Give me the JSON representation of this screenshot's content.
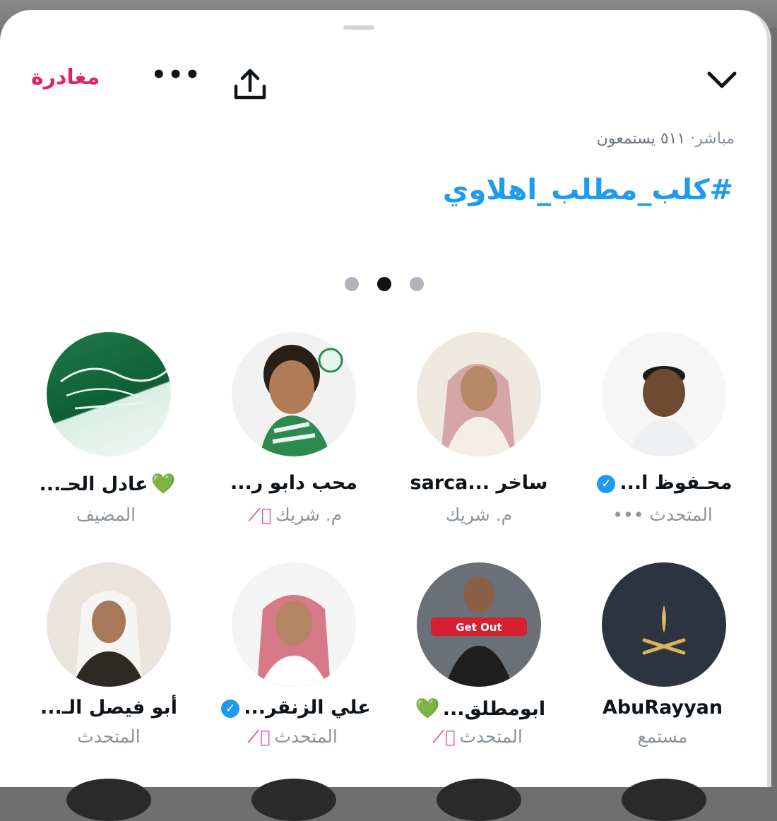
{
  "header": {
    "leave_label": "مغادرة",
    "more_label": "•••",
    "share_icon": "share-icon",
    "collapse_icon": "chevron-down-icon"
  },
  "space": {
    "live_label": "مباشر·",
    "listeners_text": "٥١١ يستمعون",
    "title": "#كلب_مطلب_اهلاوي"
  },
  "pager": {
    "count": 3,
    "active_index": 1
  },
  "members": [
    {
      "name": "عادل الحـ...",
      "role": "المضيف",
      "heart": "💚",
      "verified": false,
      "muted": false,
      "more": ""
    },
    {
      "name": "محب دابو ر...",
      "role": "م. شريك",
      "heart": "",
      "verified": false,
      "muted": true,
      "more": ""
    },
    {
      "name": "ساخر ...sarca",
      "role": "م. شريك",
      "heart": "",
      "verified": false,
      "muted": false,
      "more": ""
    },
    {
      "name": "محـفوظ ا...",
      "role": "المتحدث",
      "heart": "",
      "verified": true,
      "muted": false,
      "more": "•••"
    },
    {
      "name": "أبو فيصل الـ...",
      "role": "المتحدث",
      "heart": "",
      "verified": false,
      "muted": false,
      "more": ""
    },
    {
      "name": "علي الزنقر...",
      "role": "المتحدث",
      "heart": "",
      "verified": true,
      "muted": true,
      "more": ""
    },
    {
      "name": "ابومطلق...",
      "role": "المتحدث",
      "heart": "💚",
      "verified": false,
      "muted": true,
      "more": ""
    },
    {
      "name": "AbuRayyan",
      "role": "مستمع",
      "heart": "",
      "verified": false,
      "muted": false,
      "more": ""
    }
  ],
  "avatar_overlays": {
    "get_out_label": "Get Out"
  },
  "colors": {
    "accent": "#1d9bf0",
    "leave": "#e0245e",
    "heart": "#2bb673",
    "mute": "#e04f9a"
  }
}
